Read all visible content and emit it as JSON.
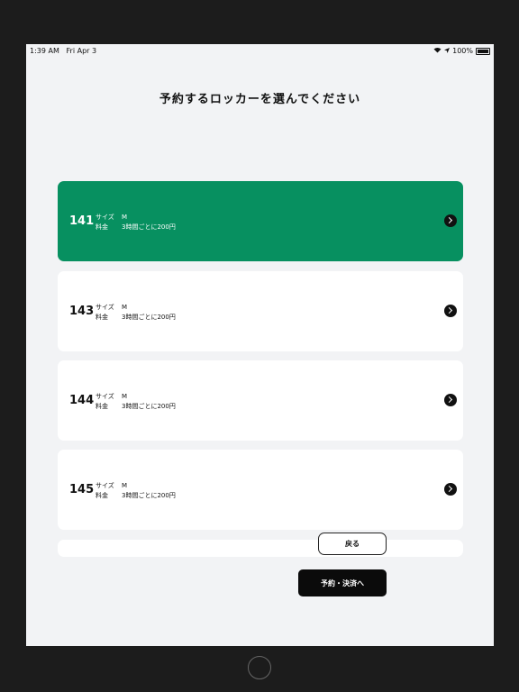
{
  "status_bar": {
    "time": "1:39 AM",
    "date": "Fri Apr 3",
    "battery": "100%"
  },
  "page": {
    "title": "予約するロッカーを選んでください"
  },
  "lockers": [
    {
      "number": "141",
      "size_label": "サイズ",
      "size": "M",
      "fee_label": "料金",
      "fee": "3時間ごとに200円",
      "selected": true
    },
    {
      "number": "143",
      "size_label": "サイズ",
      "size": "M",
      "fee_label": "料金",
      "fee": "3時間ごとに200円",
      "selected": false
    },
    {
      "number": "144",
      "size_label": "サイズ",
      "size": "M",
      "fee_label": "料金",
      "fee": "3時間ごとに200円",
      "selected": false
    },
    {
      "number": "145",
      "size_label": "サイズ",
      "size": "M",
      "fee_label": "料金",
      "fee": "3時間ごとに200円",
      "selected": false
    }
  ],
  "buttons": {
    "back": "戻る",
    "reserve_pay": "予約・決済へ"
  },
  "colors": {
    "selected_card": "#079060",
    "primary_button": "#0b0b0b"
  }
}
